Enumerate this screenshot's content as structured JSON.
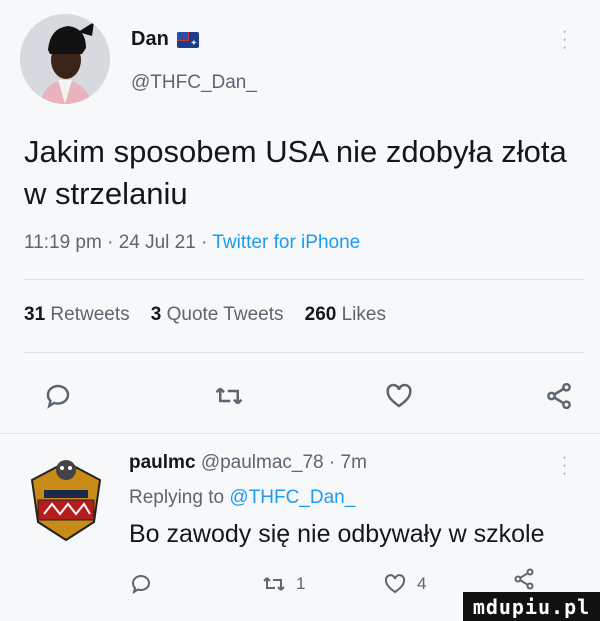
{
  "author": {
    "display_name": "Dan",
    "flag": "australia-flag",
    "handle": "@THFC_Dan_"
  },
  "tweet": {
    "text": "Jakim sposobem USA nie zdobyła złota w strzelaniu",
    "time": "11:19 pm",
    "date": "24 Jul 21",
    "source": "Twitter for iPhone",
    "separator": "·"
  },
  "stats": {
    "retweets_count": "31",
    "retweets_label": "Retweets",
    "quotes_count": "3",
    "quotes_label": "Quote Tweets",
    "likes_count": "260",
    "likes_label": "Likes"
  },
  "actions": [
    "reply-icon",
    "retweet-icon",
    "like-icon",
    "share-icon"
  ],
  "reply": {
    "display_name": "paulmc",
    "handle": "@paulmac_78",
    "age": "7m",
    "replying_prefix": "Replying to",
    "replying_to": "@THFC_Dan_",
    "text": "Bo zawody się nie odbywały w szkole",
    "retweet_count": "1",
    "like_count": "4"
  },
  "watermark": "mdupiu.pl",
  "colors": {
    "link": "#1d9bf0",
    "muted": "#5b6670",
    "text": "#14171a"
  }
}
